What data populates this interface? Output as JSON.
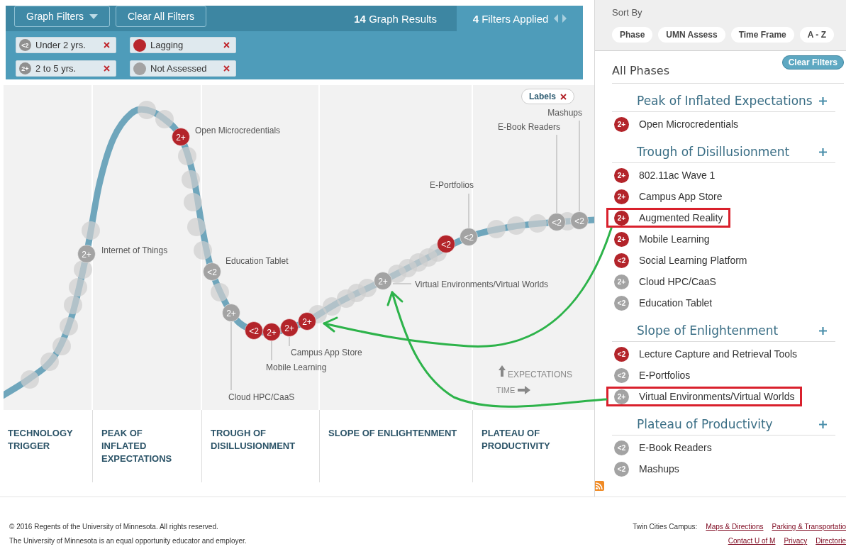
{
  "toolbar": {
    "filter_menu": "Graph Filters",
    "clear_all": "Clear All Filters",
    "results_count": "14",
    "results_label": "Graph Results",
    "filters_count": "4",
    "filters_label": "Filters Applied"
  },
  "filter_chips": [
    {
      "kind": "timeframe",
      "badge": "<2",
      "label": "Under 2 yrs."
    },
    {
      "kind": "status",
      "color": "#b8262c",
      "label": "Lagging"
    },
    {
      "kind": "timeframe",
      "badge": "2+",
      "label": "2 to 5 yrs."
    },
    {
      "kind": "status",
      "color": "#a3a3a3",
      "label": "Not Assessed"
    }
  ],
  "chart": {
    "labels_toggle": "Labels",
    "axis": {
      "y": "EXPECTATIONS",
      "x": "TIME"
    },
    "markers": [
      {
        "badge": "2+",
        "color": "#b3242a",
        "label": "Open Microcredentials"
      },
      {
        "badge": "<2",
        "color": "#a3a3a3",
        "label": "Mashups"
      },
      {
        "badge": "<2",
        "color": "#a3a3a3",
        "label": "E-Book Readers"
      },
      {
        "badge": "<2",
        "color": "#a3a3a3",
        "label": "E-Portfolios"
      },
      {
        "badge": "<2",
        "color": "#b3242a"
      },
      {
        "badge": "2+",
        "color": "#a3a3a3",
        "label": "Internet of Things"
      },
      {
        "badge": "<2",
        "color": "#a3a3a3",
        "label": "Education Tablet"
      },
      {
        "badge": "2+",
        "color": "#a3a3a3",
        "label": "Virtual Environments/Virtual Worlds"
      },
      {
        "badge": "2+",
        "color": "#a3a3a3",
        "label": "Cloud HPC/CaaS"
      },
      {
        "badge": "<2",
        "color": "#b3242a"
      },
      {
        "badge": "2+",
        "color": "#b3242a",
        "label": "Mobile Learning"
      },
      {
        "badge": "2+",
        "color": "#b3242a",
        "label": "Campus App Store"
      },
      {
        "badge": "2+",
        "color": "#b3242a"
      }
    ]
  },
  "phases": [
    {
      "title": "TECHNOLOGY TRIGGER"
    },
    {
      "title": "PEAK OF INFLATED EXPECTATIONS"
    },
    {
      "title": "TROUGH OF DISILLUSIONMENT"
    },
    {
      "title": "SLOPE OF ENLIGHTENMENT"
    },
    {
      "title": "PLATEAU OF PRODUCTIVITY"
    }
  ],
  "sidebar": {
    "sort_title": "Sort By",
    "sort_options": [
      {
        "label": "Phase",
        "selected": false
      },
      {
        "label": "UMN Assess",
        "selected": false
      },
      {
        "label": "Time Frame",
        "selected": false
      },
      {
        "label": "A - Z",
        "selected": false
      }
    ],
    "list_title": "All Phases",
    "clear_filters": "Clear Filters",
    "groups": [
      {
        "title": "Peak of Inflated Expectations",
        "items": [
          {
            "badge": "2+",
            "color": "#b3242a",
            "label": "Open Microcredentials",
            "highlighted": false
          }
        ]
      },
      {
        "title": "Trough of Disillusionment",
        "items": [
          {
            "badge": "2+",
            "color": "#b3242a",
            "label": "802.11ac Wave 1",
            "highlighted": false
          },
          {
            "badge": "2+",
            "color": "#b3242a",
            "label": "Campus App Store",
            "highlighted": false
          },
          {
            "badge": "2+",
            "color": "#b3242a",
            "label": "Augmented Reality",
            "highlighted": true
          },
          {
            "badge": "2+",
            "color": "#b3242a",
            "label": "Mobile Learning",
            "highlighted": false
          },
          {
            "badge": "<2",
            "color": "#b3242a",
            "label": "Social Learning Platform",
            "highlighted": false
          },
          {
            "badge": "2+",
            "color": "#a3a3a3",
            "label": "Cloud HPC/CaaS",
            "highlighted": false
          },
          {
            "badge": "<2",
            "color": "#a3a3a3",
            "label": "Education Tablet",
            "highlighted": false
          }
        ]
      },
      {
        "title": "Slope of Enlightenment",
        "items": [
          {
            "badge": "<2",
            "color": "#b3242a",
            "label": "Lecture Capture and Retrieval Tools",
            "highlighted": false
          },
          {
            "badge": "<2",
            "color": "#a3a3a3",
            "label": "E-Portfolios",
            "highlighted": false
          },
          {
            "badge": "2+",
            "color": "#a3a3a3",
            "label": "Virtual Environments/Virtual Worlds",
            "highlighted": true
          }
        ]
      },
      {
        "title": "Plateau of Productivity",
        "items": [
          {
            "badge": "<2",
            "color": "#a3a3a3",
            "label": "E-Book Readers",
            "highlighted": false
          },
          {
            "badge": "<2",
            "color": "#a3a3a3",
            "label": "Mashups",
            "highlighted": false
          }
        ]
      }
    ]
  },
  "footer": {
    "copyright": "© 2016 Regents of the University of Minnesota. All rights reserved.",
    "equal_opportunity": "The University of Minnesota is an equal opportunity educator and employer.",
    "campus_label": "Twin Cities Campus:",
    "links_row_1": [
      "Maps & Directions",
      "Parking & Transportatio"
    ],
    "links_row_2": [
      "Contact U of M",
      "Privacy",
      "Directorie"
    ]
  }
}
